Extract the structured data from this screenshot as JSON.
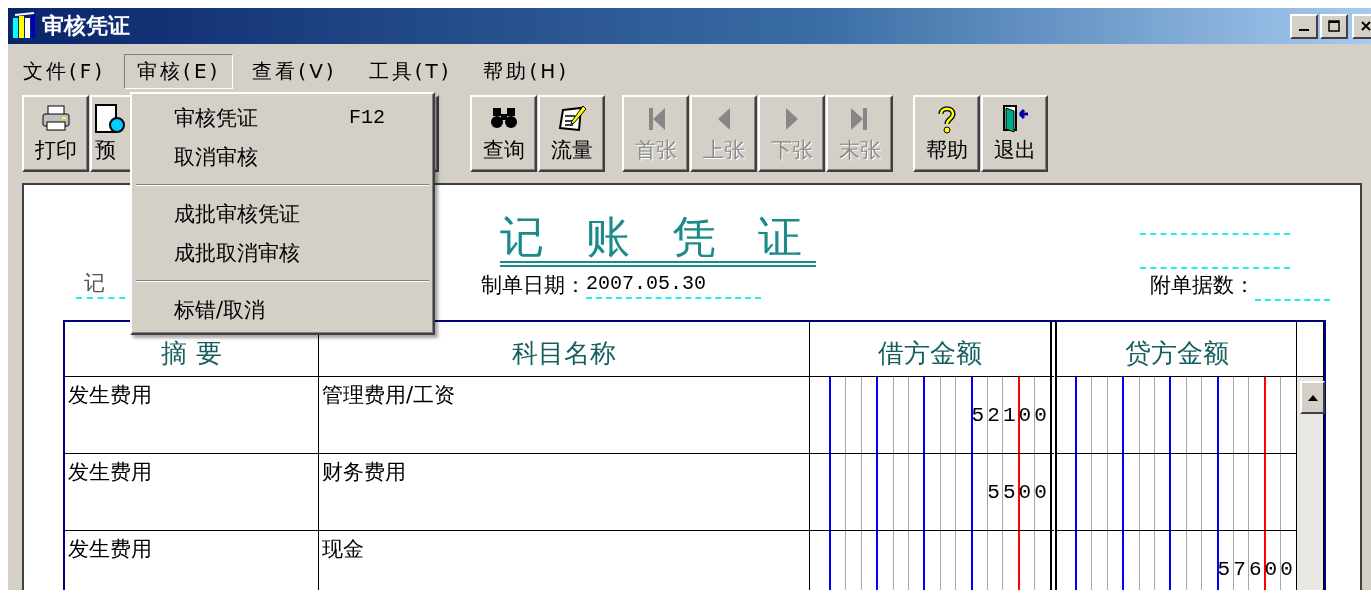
{
  "window": {
    "title": "审核凭证"
  },
  "menu_bar": [
    {
      "label": "文件(F)",
      "selected": false
    },
    {
      "label": "审核(E)",
      "selected": true
    },
    {
      "label": "查看(V)",
      "selected": false
    },
    {
      "label": "工具(T)",
      "selected": false
    },
    {
      "label": "帮助(H)",
      "selected": false
    }
  ],
  "toolbar": [
    {
      "buttons": [
        {
          "label": "打印",
          "disabled": false
        },
        {
          "label": "预",
          "disabled": false
        }
      ]
    },
    {
      "buttons": [
        {
          "label": "查询",
          "disabled": false
        },
        {
          "label": "流量",
          "disabled": false
        }
      ]
    },
    {
      "buttons": [
        {
          "label": "首张",
          "disabled": true
        },
        {
          "label": "上张",
          "disabled": true
        },
        {
          "label": "下张",
          "disabled": true
        },
        {
          "label": "末张",
          "disabled": true
        }
      ]
    },
    {
      "buttons": [
        {
          "label": "帮助",
          "disabled": false
        },
        {
          "label": "退出",
          "disabled": false
        }
      ]
    }
  ],
  "menu_dropdown": [
    {
      "kind": "item",
      "label": "审核凭证",
      "shortcut": "F12"
    },
    {
      "kind": "item",
      "label": "取消审核"
    },
    {
      "kind": "separator"
    },
    {
      "kind": "item",
      "label": "成批审核凭证"
    },
    {
      "kind": "item",
      "label": "成批取消审核"
    },
    {
      "kind": "separator"
    },
    {
      "kind": "item",
      "label": "标错/取消"
    }
  ],
  "voucher": {
    "title": "记 账 凭 证",
    "type": "记",
    "date_label": "制单日期：",
    "date": "2007.05.30",
    "attachments_label": "附单据数：",
    "columns": [
      "摘 要",
      "科目名称",
      "借方金额",
      "贷方金额"
    ],
    "rows": [
      {
        "summary": "发生费用",
        "account": "管理费用/工资",
        "debit": "52100"
      },
      {
        "summary": "发生费用",
        "account": "财务费用",
        "debit": "5500"
      },
      {
        "summary": "发生费用",
        "account": "现金",
        "credit": "57600"
      }
    ]
  }
}
